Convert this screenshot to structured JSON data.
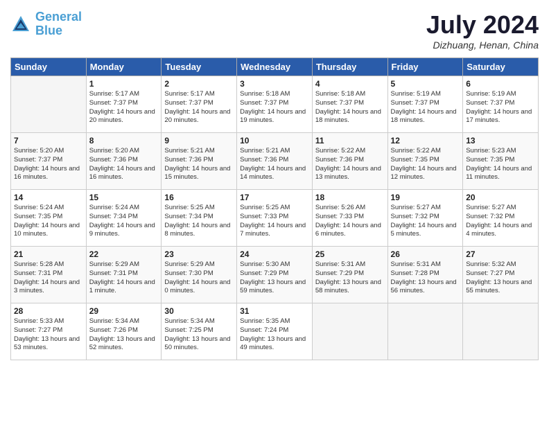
{
  "logo": {
    "line1": "General",
    "line2": "Blue"
  },
  "title": "July 2024",
  "location": "Dizhuang, Henan, China",
  "days_of_week": [
    "Sunday",
    "Monday",
    "Tuesday",
    "Wednesday",
    "Thursday",
    "Friday",
    "Saturday"
  ],
  "weeks": [
    [
      {
        "day": "",
        "info": ""
      },
      {
        "day": "1",
        "info": "Sunrise: 5:17 AM\nSunset: 7:37 PM\nDaylight: 14 hours\nand 20 minutes."
      },
      {
        "day": "2",
        "info": "Sunrise: 5:17 AM\nSunset: 7:37 PM\nDaylight: 14 hours\nand 20 minutes."
      },
      {
        "day": "3",
        "info": "Sunrise: 5:18 AM\nSunset: 7:37 PM\nDaylight: 14 hours\nand 19 minutes."
      },
      {
        "day": "4",
        "info": "Sunrise: 5:18 AM\nSunset: 7:37 PM\nDaylight: 14 hours\nand 18 minutes."
      },
      {
        "day": "5",
        "info": "Sunrise: 5:19 AM\nSunset: 7:37 PM\nDaylight: 14 hours\nand 18 minutes."
      },
      {
        "day": "6",
        "info": "Sunrise: 5:19 AM\nSunset: 7:37 PM\nDaylight: 14 hours\nand 17 minutes."
      }
    ],
    [
      {
        "day": "7",
        "info": "Sunrise: 5:20 AM\nSunset: 7:37 PM\nDaylight: 14 hours\nand 16 minutes."
      },
      {
        "day": "8",
        "info": "Sunrise: 5:20 AM\nSunset: 7:36 PM\nDaylight: 14 hours\nand 16 minutes."
      },
      {
        "day": "9",
        "info": "Sunrise: 5:21 AM\nSunset: 7:36 PM\nDaylight: 14 hours\nand 15 minutes."
      },
      {
        "day": "10",
        "info": "Sunrise: 5:21 AM\nSunset: 7:36 PM\nDaylight: 14 hours\nand 14 minutes."
      },
      {
        "day": "11",
        "info": "Sunrise: 5:22 AM\nSunset: 7:36 PM\nDaylight: 14 hours\nand 13 minutes."
      },
      {
        "day": "12",
        "info": "Sunrise: 5:22 AM\nSunset: 7:35 PM\nDaylight: 14 hours\nand 12 minutes."
      },
      {
        "day": "13",
        "info": "Sunrise: 5:23 AM\nSunset: 7:35 PM\nDaylight: 14 hours\nand 11 minutes."
      }
    ],
    [
      {
        "day": "14",
        "info": "Sunrise: 5:24 AM\nSunset: 7:35 PM\nDaylight: 14 hours\nand 10 minutes."
      },
      {
        "day": "15",
        "info": "Sunrise: 5:24 AM\nSunset: 7:34 PM\nDaylight: 14 hours\nand 9 minutes."
      },
      {
        "day": "16",
        "info": "Sunrise: 5:25 AM\nSunset: 7:34 PM\nDaylight: 14 hours\nand 8 minutes."
      },
      {
        "day": "17",
        "info": "Sunrise: 5:25 AM\nSunset: 7:33 PM\nDaylight: 14 hours\nand 7 minutes."
      },
      {
        "day": "18",
        "info": "Sunrise: 5:26 AM\nSunset: 7:33 PM\nDaylight: 14 hours\nand 6 minutes."
      },
      {
        "day": "19",
        "info": "Sunrise: 5:27 AM\nSunset: 7:32 PM\nDaylight: 14 hours\nand 5 minutes."
      },
      {
        "day": "20",
        "info": "Sunrise: 5:27 AM\nSunset: 7:32 PM\nDaylight: 14 hours\nand 4 minutes."
      }
    ],
    [
      {
        "day": "21",
        "info": "Sunrise: 5:28 AM\nSunset: 7:31 PM\nDaylight: 14 hours\nand 3 minutes."
      },
      {
        "day": "22",
        "info": "Sunrise: 5:29 AM\nSunset: 7:31 PM\nDaylight: 14 hours\nand 1 minute."
      },
      {
        "day": "23",
        "info": "Sunrise: 5:29 AM\nSunset: 7:30 PM\nDaylight: 14 hours\nand 0 minutes."
      },
      {
        "day": "24",
        "info": "Sunrise: 5:30 AM\nSunset: 7:29 PM\nDaylight: 13 hours\nand 59 minutes."
      },
      {
        "day": "25",
        "info": "Sunrise: 5:31 AM\nSunset: 7:29 PM\nDaylight: 13 hours\nand 58 minutes."
      },
      {
        "day": "26",
        "info": "Sunrise: 5:31 AM\nSunset: 7:28 PM\nDaylight: 13 hours\nand 56 minutes."
      },
      {
        "day": "27",
        "info": "Sunrise: 5:32 AM\nSunset: 7:27 PM\nDaylight: 13 hours\nand 55 minutes."
      }
    ],
    [
      {
        "day": "28",
        "info": "Sunrise: 5:33 AM\nSunset: 7:27 PM\nDaylight: 13 hours\nand 53 minutes."
      },
      {
        "day": "29",
        "info": "Sunrise: 5:34 AM\nSunset: 7:26 PM\nDaylight: 13 hours\nand 52 minutes."
      },
      {
        "day": "30",
        "info": "Sunrise: 5:34 AM\nSunset: 7:25 PM\nDaylight: 13 hours\nand 50 minutes."
      },
      {
        "day": "31",
        "info": "Sunrise: 5:35 AM\nSunset: 7:24 PM\nDaylight: 13 hours\nand 49 minutes."
      },
      {
        "day": "",
        "info": ""
      },
      {
        "day": "",
        "info": ""
      },
      {
        "day": "",
        "info": ""
      }
    ]
  ]
}
